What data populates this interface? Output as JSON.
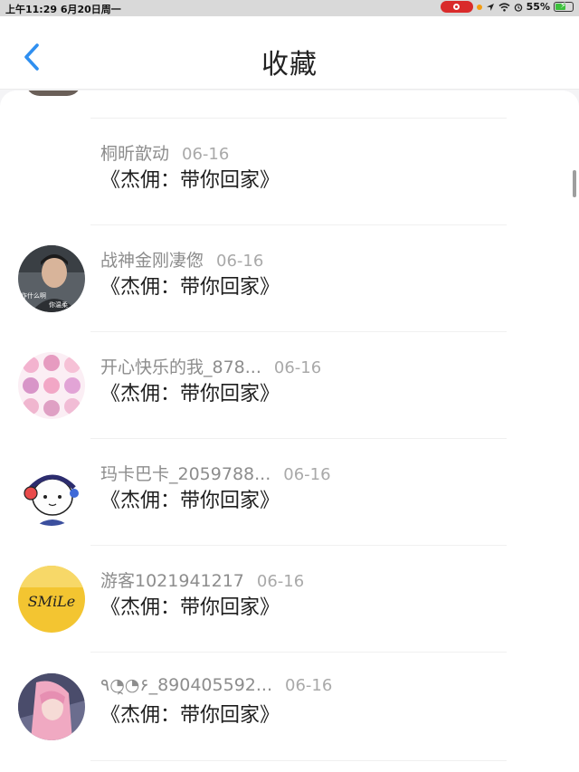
{
  "status_bar": {
    "time": "上午11:29   6月20日周一",
    "battery": "55%"
  },
  "header": {
    "title": "收藏"
  },
  "comments": [
    {
      "user": "桐昕歆动",
      "date": "06-16",
      "text": "《杰佣：带你回家》",
      "avatar": "none"
    },
    {
      "user": "战神金刚凄偬",
      "date": "06-16",
      "text": "《杰佣：带你回家》",
      "avatar": "photo",
      "avatar_caption_1": "作什么啊",
      "avatar_caption_2": "你温柔"
    },
    {
      "user": "开心快乐的我_878...",
      "date": "06-16",
      "text": "《杰佣：带你回家》",
      "avatar": "sticker-grid"
    },
    {
      "user": "玛卡巴卡_2059788...",
      "date": "06-16",
      "text": "《杰佣：带你回家》",
      "avatar": "headphones-cartoon"
    },
    {
      "user": "游客1021941217",
      "date": "06-16",
      "text": "《杰佣：带你回家》",
      "avatar": "smile-logo",
      "avatar_text": "SMiLe"
    },
    {
      "user": "٩◔̯◔۶_890405592...",
      "date": "06-16",
      "text": "《杰佣：带你回家》",
      "avatar": "anime-pink"
    }
  ],
  "colors": {
    "accent": "#2f8ff0",
    "status_red": "#d92b2b"
  }
}
